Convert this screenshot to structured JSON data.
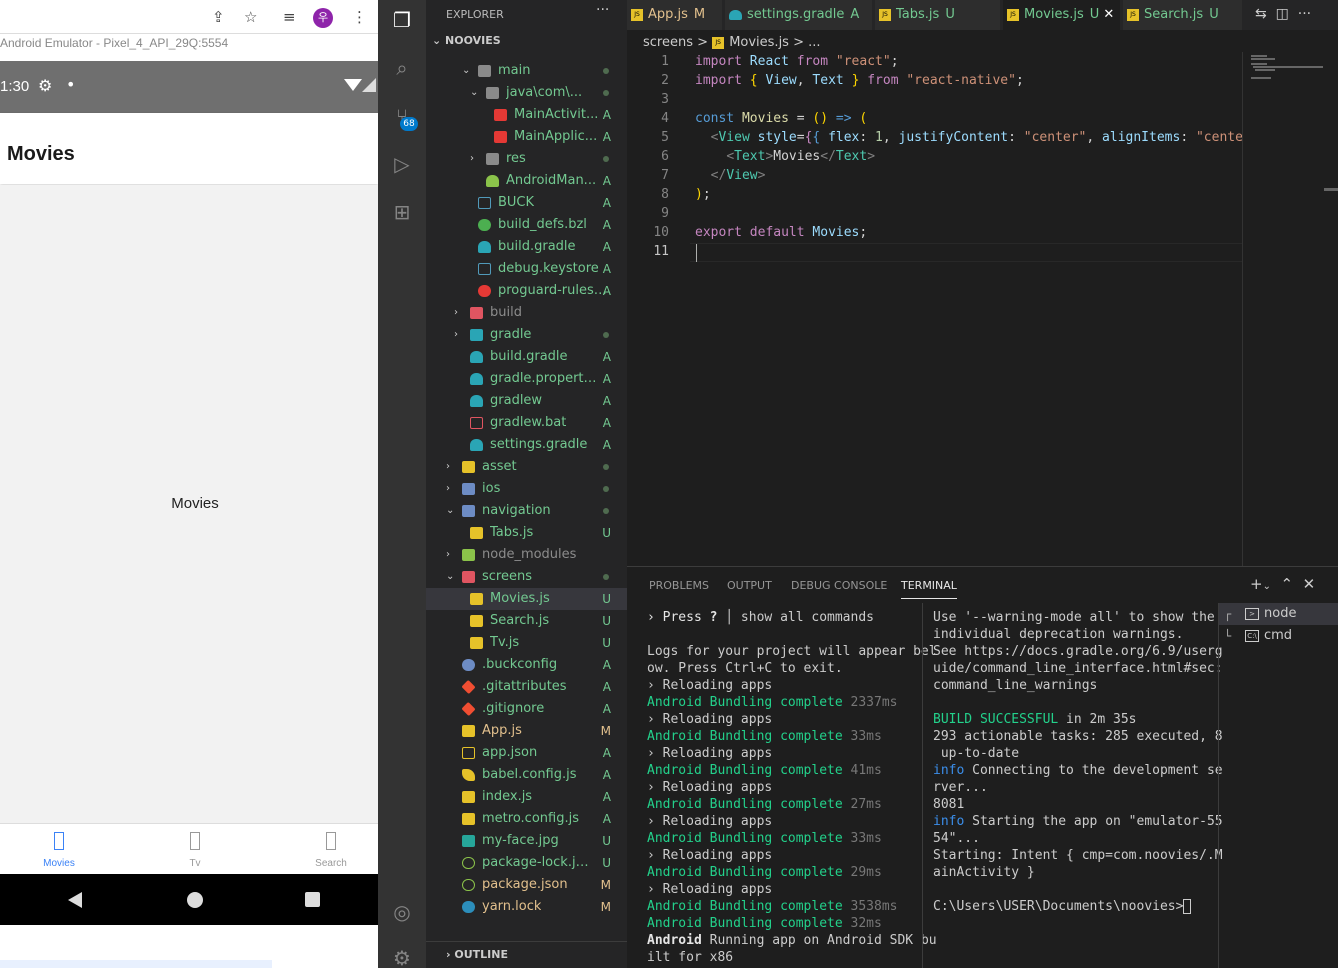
{
  "emulator": {
    "title": "Android Emulator - Pixel_4_API_29Q:5554",
    "avatar": "우",
    "time": "1:30",
    "header": "Movies",
    "body_text": "Movies",
    "tabs": [
      {
        "label": "Movies",
        "active": true
      },
      {
        "label": "Tv",
        "active": false
      },
      {
        "label": "Search",
        "active": false
      }
    ]
  },
  "activity": {
    "scm_badge": "68"
  },
  "explorer": {
    "header": "EXPLORER",
    "project": "NOOVIES",
    "outline": "OUTLINE",
    "rows": [
      {
        "d": 2,
        "t": "f",
        "n": "main",
        "c": "o",
        "s": "dot"
      },
      {
        "d": 3,
        "t": "f",
        "n": "java\\com\\...",
        "c": "o",
        "s": "dot"
      },
      {
        "d": 4,
        "t": "j",
        "n": "MainActivit...",
        "s": "A"
      },
      {
        "d": 4,
        "t": "j",
        "n": "MainApplic...",
        "s": "A"
      },
      {
        "d": 3,
        "t": "f",
        "n": "res",
        "c": "c",
        "s": "dot"
      },
      {
        "d": 3,
        "t": "a",
        "n": "AndroidMan...",
        "s": "A"
      },
      {
        "d": 2,
        "t": "b",
        "n": "BUCK",
        "s": "A"
      },
      {
        "d": 2,
        "t": "g",
        "n": "build_defs.bzl",
        "s": "A"
      },
      {
        "d": 2,
        "t": "gr",
        "n": "build.gradle",
        "s": "A"
      },
      {
        "d": 2,
        "t": "b",
        "n": "debug.keystore",
        "s": "A"
      },
      {
        "d": 2,
        "t": "p",
        "n": "proguard-rules....",
        "s": "A"
      },
      {
        "d": 1,
        "t": "fr",
        "n": "build",
        "c": "c",
        "s": ""
      },
      {
        "d": 1,
        "t": "ft",
        "n": "gradle",
        "c": "c",
        "s": "dot"
      },
      {
        "d": 1,
        "t": "gr",
        "n": "build.gradle",
        "s": "A"
      },
      {
        "d": 1,
        "t": "gr",
        "n": "gradle.properties",
        "s": "A"
      },
      {
        "d": 1,
        "t": "gr",
        "n": "gradlew",
        "s": "A"
      },
      {
        "d": 1,
        "t": "bat",
        "n": "gradlew.bat",
        "s": "A"
      },
      {
        "d": 1,
        "t": "gr",
        "n": "settings.gradle",
        "s": "A"
      },
      {
        "d": 0,
        "t": "fy",
        "n": "asset",
        "c": "c",
        "s": "dot"
      },
      {
        "d": 0,
        "t": "fb",
        "n": "ios",
        "c": "c",
        "s": "dot"
      },
      {
        "d": 0,
        "t": "fo",
        "n": "navigation",
        "c": "o",
        "s": "dot"
      },
      {
        "d": 1,
        "t": "js",
        "n": "Tabs.js",
        "s": "U"
      },
      {
        "d": 0,
        "t": "fg",
        "n": "node_modules",
        "c": "c",
        "s": ""
      },
      {
        "d": 0,
        "t": "fr",
        "n": "screens",
        "c": "o",
        "s": "dot"
      },
      {
        "d": 1,
        "t": "js",
        "n": "Movies.js",
        "s": "U",
        "sel": true
      },
      {
        "d": 1,
        "t": "js",
        "n": "Search.js",
        "s": "U"
      },
      {
        "d": 1,
        "t": "js",
        "n": "Tv.js",
        "s": "U"
      },
      {
        "d": 0,
        "t": "bc",
        "n": ".buckconfig",
        "s": "A"
      },
      {
        "d": 0,
        "t": "git",
        "n": ".gitattributes",
        "s": "A"
      },
      {
        "d": 0,
        "t": "git",
        "n": ".gitignore",
        "s": "A"
      },
      {
        "d": 0,
        "t": "js",
        "n": "App.js",
        "s": "M"
      },
      {
        "d": 0,
        "t": "json",
        "n": "app.json",
        "s": "A"
      },
      {
        "d": 0,
        "t": "babel",
        "n": "babel.config.js",
        "s": "A"
      },
      {
        "d": 0,
        "t": "js",
        "n": "index.js",
        "s": "A"
      },
      {
        "d": 0,
        "t": "js",
        "n": "metro.config.js",
        "s": "A"
      },
      {
        "d": 0,
        "t": "img",
        "n": "my-face.jpg",
        "s": "U"
      },
      {
        "d": 0,
        "t": "npm",
        "n": "package-lock.json",
        "s": "U"
      },
      {
        "d": 0,
        "t": "npm",
        "n": "package.json",
        "s": "M"
      },
      {
        "d": 0,
        "t": "yarn",
        "n": "yarn.lock",
        "s": "M"
      }
    ]
  },
  "editor": {
    "tabs": [
      {
        "n": "App.js",
        "s": "M",
        "t": "js"
      },
      {
        "n": "settings.gradle",
        "s": "A",
        "t": "gr"
      },
      {
        "n": "Tabs.js",
        "s": "U",
        "t": "js"
      },
      {
        "n": "Movies.js",
        "s": "U",
        "t": "js",
        "on": true
      },
      {
        "n": "Search.js",
        "s": "U",
        "t": "js"
      }
    ],
    "breadcrumb": [
      "screens",
      ">",
      "Movies.js",
      ">",
      "..."
    ],
    "lines": [
      "1",
      "2",
      "3",
      "4",
      "5",
      "6",
      "7",
      "8",
      "9",
      "10",
      "11"
    ]
  },
  "panel": {
    "tabs": [
      "PROBLEMS",
      "OUTPUT",
      "DEBUG CONSOLE",
      "TERMINAL"
    ],
    "terminals": [
      "node",
      "cmd"
    ]
  }
}
